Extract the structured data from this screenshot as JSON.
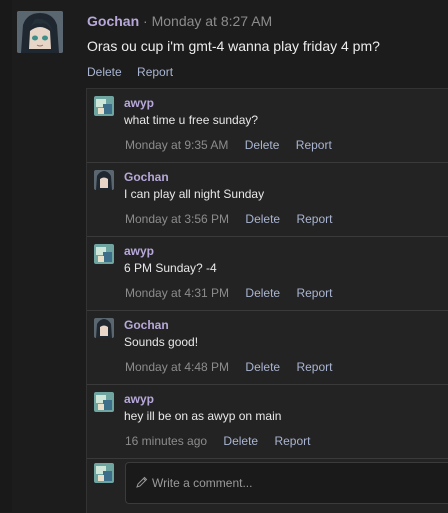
{
  "post": {
    "author": "Gochan",
    "separator": "·",
    "time": "Monday at 8:27 AM",
    "text": "Oras ou cup i'm gmt-4 wanna play friday 4 pm?",
    "delete_label": "Delete",
    "report_label": "Report"
  },
  "comments": [
    {
      "author": "awyp",
      "avatar": "awyp-avatar",
      "text": "what time u free sunday?",
      "time": "Monday at 9:35 AM",
      "delete_label": "Delete",
      "report_label": "Report"
    },
    {
      "author": "Gochan",
      "avatar": "gochan-avatar",
      "text": "I can play all night Sunday",
      "time": "Monday at 3:56 PM",
      "delete_label": "Delete",
      "report_label": "Report"
    },
    {
      "author": "awyp",
      "avatar": "awyp-avatar",
      "text": "6 PM Sunday? -4",
      "time": "Monday at 4:31 PM",
      "delete_label": "Delete",
      "report_label": "Report"
    },
    {
      "author": "Gochan",
      "avatar": "gochan-avatar",
      "text": "Sounds good!",
      "time": "Monday at 4:48 PM",
      "delete_label": "Delete",
      "report_label": "Report"
    },
    {
      "author": "awyp",
      "avatar": "awyp-avatar",
      "text": "hey ill be on as awyp on main",
      "time": "16 minutes ago",
      "delete_label": "Delete",
      "report_label": "Report"
    }
  ],
  "reply": {
    "placeholder": "Write a comment..."
  },
  "colors": {
    "author": "#b7a8d9",
    "action": "#a9b5d2",
    "background": "#1c1c1c"
  }
}
